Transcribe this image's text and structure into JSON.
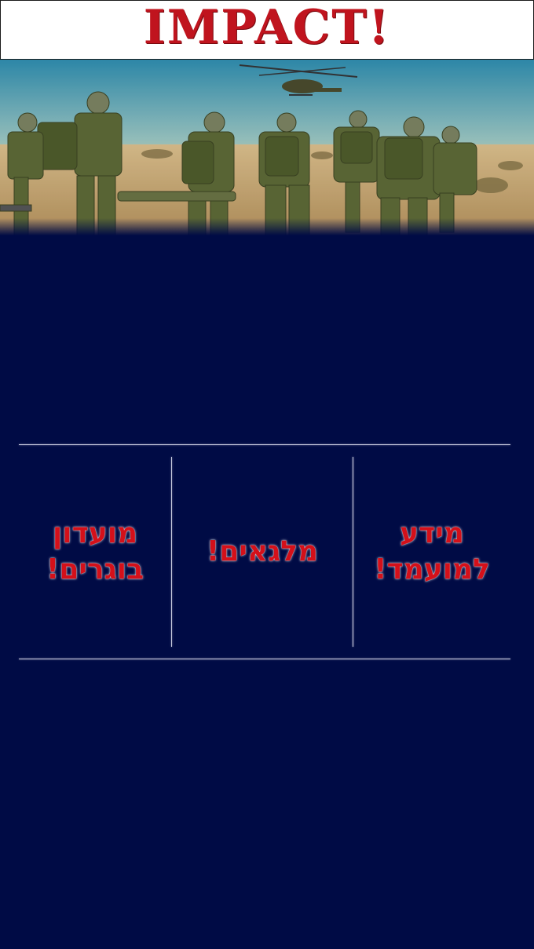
{
  "header": {
    "logo_text": "IMPACT!"
  },
  "hero": {
    "image_description_icon": "soldiers-helicopter-image"
  },
  "menu": {
    "items": [
      {
        "label": "מידע\nלמועמד!"
      },
      {
        "label": "מלגאים!"
      },
      {
        "label": "מועדון\nבוגרים!"
      }
    ]
  },
  "colors": {
    "background": "#000b45",
    "accent_red": "#d4101a",
    "divider": "#c9cce0"
  }
}
